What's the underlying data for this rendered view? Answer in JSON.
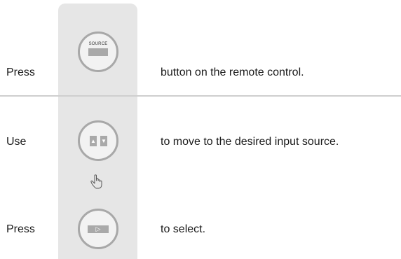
{
  "steps": [
    {
      "lead": "Press",
      "text": "button on the remote control.",
      "button": "SOURCE"
    },
    {
      "lead": "Use",
      "text": "to move to the desired input source.",
      "button": "up-down-arrows"
    },
    {
      "lead": "Press",
      "text": "to select.",
      "button": "enter"
    }
  ],
  "source_button_label": "SOURCE",
  "icons": {
    "up_arrow": "▲",
    "down_arrow": "▼",
    "play_arrow": "▷",
    "hand": "pointing-hand-icon"
  },
  "colors": {
    "panel": "#e6e6e6",
    "button_ring": "#a8a8a8",
    "button_key": "#a9a9a9",
    "divider": "#cfcfcf"
  }
}
